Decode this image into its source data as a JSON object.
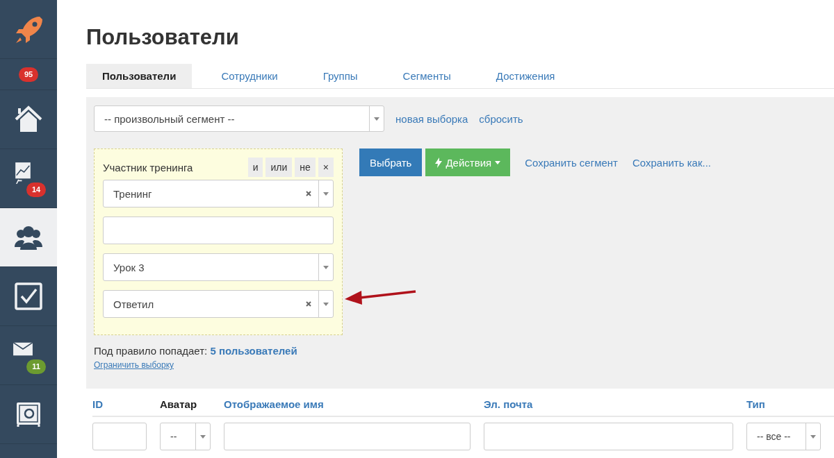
{
  "sidebar": {
    "items": [
      {
        "kind": "icon",
        "selected": false
      },
      {
        "kind": "badge",
        "badge": "95",
        "color": "#d9312d",
        "selected": false
      },
      {
        "kind": "icon",
        "selected": false
      },
      {
        "kind": "icon",
        "badge": "14",
        "color": "#d9312d",
        "selected": false
      },
      {
        "kind": "icon",
        "selected": true
      },
      {
        "kind": "icon",
        "selected": false
      },
      {
        "kind": "icon",
        "badge": "11",
        "color": "#6c9b30",
        "selected": false
      },
      {
        "kind": "icon",
        "selected": false
      }
    ]
  },
  "page": {
    "title": "Пользователи"
  },
  "tabs": [
    {
      "label": "Пользователи",
      "selected": true
    },
    {
      "label": "Сотрудники",
      "selected": false
    },
    {
      "label": "Группы",
      "selected": false
    },
    {
      "label": "Сегменты",
      "selected": false
    },
    {
      "label": "Достижения",
      "selected": false
    }
  ],
  "filter": {
    "segment": {
      "value": "-- произвольный сегмент --"
    },
    "links": [
      "новая выборка",
      "сбросить"
    ],
    "rule": {
      "label": "Участник тренинга",
      "operators": [
        "и",
        "или",
        "не",
        "×"
      ],
      "fields": [
        {
          "kind": "select",
          "value": "Тренинг",
          "clearable": true
        },
        {
          "kind": "input"
        },
        {
          "kind": "select",
          "value": "Урок 3",
          "clearable": false
        },
        {
          "kind": "select",
          "value": "Ответил",
          "clearable": true
        }
      ]
    },
    "buttons": [
      {
        "label": "Выбрать",
        "kind": "primary"
      },
      {
        "label": "Действия",
        "kind": "actions"
      }
    ],
    "actions": [
      "Сохранить сегмент",
      "Сохранить как..."
    ],
    "result": {
      "text": "Под правило попадает: ",
      "count": "5 пользователей",
      "limit_link": "Ограничить выборку"
    }
  },
  "table": {
    "columns": [
      {
        "label": "ID",
        "sortable": true,
        "filter": {
          "kind": "input"
        }
      },
      {
        "label": "Аватар",
        "sortable": false,
        "filter": {
          "kind": "select",
          "value": "--"
        }
      },
      {
        "label": "Отображаемое имя",
        "sortable": true,
        "filter": {
          "kind": "input"
        }
      },
      {
        "label": "Эл. почта",
        "sortable": true,
        "filter": {
          "kind": "input"
        }
      },
      {
        "label": "Тип",
        "sortable": true,
        "filter": {
          "kind": "select",
          "value": "-- все --"
        }
      }
    ]
  }
}
